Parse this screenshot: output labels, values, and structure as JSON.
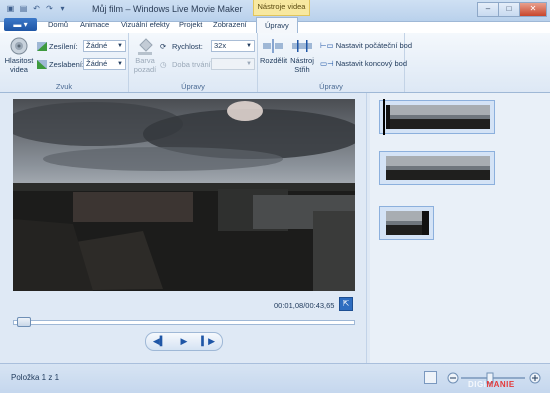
{
  "window": {
    "title": "Můj film – Windows Live Movie Maker",
    "context_tab": "Nástroje videa"
  },
  "tabs": [
    "Domů",
    "Animace",
    "Vizuální efekty",
    "Projekt",
    "Zobrazení",
    "Úpravy"
  ],
  "ribbon": {
    "zvuk": {
      "label": "Zvuk",
      "volume_button": "Hlasitost videa",
      "fade_in_label": "Zesílení:",
      "fade_in_value": "Žádné",
      "fade_out_label": "Zeslabení:",
      "fade_out_value": "Žádné"
    },
    "upravy1": {
      "label": "Úpravy",
      "bg_color": "Barva pozadí",
      "speed_label": "Rychlost:",
      "speed_value": "32x",
      "duration_label": "Doba trvání:",
      "duration_value": ""
    },
    "upravy2": {
      "label": "Úpravy",
      "split": "Rozdělit",
      "trim": "Nástroj Střih",
      "set_start": "Nastavit počáteční bod",
      "set_end": "Nastavit koncový bod"
    }
  },
  "player": {
    "time": "00:01,08/00:43,65",
    "progress": 0.02
  },
  "storyboard": {
    "clips": 3,
    "selected": 0
  },
  "status": {
    "text": "Položka 1 z 1",
    "watermark_a": "DIGI",
    "watermark_b": "MANIE"
  },
  "colors": {
    "accent": "#1f56a6",
    "ribbon_bg": "#dde8f5",
    "workspace": "#dfe9f5"
  }
}
